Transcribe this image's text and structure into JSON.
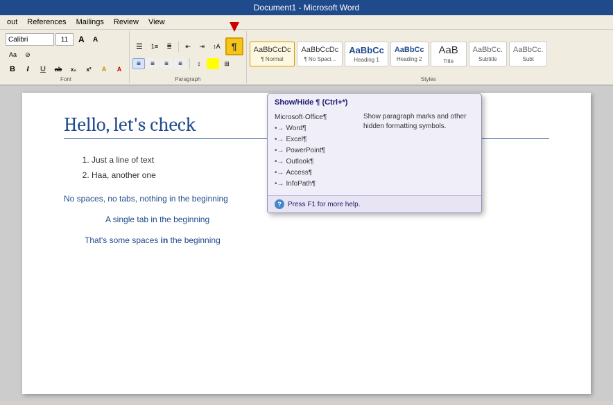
{
  "titleBar": {
    "text": "Document1 - Microsoft Word"
  },
  "menuBar": {
    "items": [
      "out",
      "References",
      "Mailings",
      "Review",
      "View"
    ]
  },
  "ribbon": {
    "fontSection": {
      "label": "Font",
      "fontName": "Calibri",
      "fontSize": "11",
      "formatButtons": [
        "B",
        "I",
        "U",
        "ab",
        "x₂",
        "x²",
        "Aa",
        "A",
        "A"
      ]
    },
    "paragraphSection": {
      "label": "Paragraph"
    },
    "stylesSection": {
      "label": "Styles",
      "styles": [
        {
          "name": "¶ Normal",
          "label": "¶ Normal",
          "sublabel": ""
        },
        {
          "name": "¶ No Spaci...",
          "label": "¶ No Spaci...",
          "sublabel": ""
        },
        {
          "name": "Heading 1",
          "label": "Heading 1",
          "sublabel": ""
        },
        {
          "name": "Heading 2",
          "label": "Heading 2",
          "sublabel": ""
        },
        {
          "name": "Title",
          "label": "Title",
          "sublabel": ""
        },
        {
          "name": "Subtitle",
          "label": "Subtitle",
          "sublabel": ""
        },
        {
          "name": "AaBbCc.",
          "label": "Subt",
          "sublabel": ""
        }
      ]
    },
    "pilcrowButton": "¶"
  },
  "tooltip": {
    "title": "Show/Hide ¶ (Ctrl+*)",
    "previewTitle": "Microsoft·Office¶",
    "previewItems": [
      "Word¶",
      "Excel¶",
      "PowerPoint¶",
      "Outlook¶",
      "Access¶",
      "InfoPath¶"
    ],
    "description": "Show paragraph marks and other hidden formatting symbols.",
    "helpText": "Press F1 for more help."
  },
  "document": {
    "heading": "Hello, let's check",
    "listItems": [
      "Just a line of text",
      "Haa, another one"
    ],
    "paragraphs": [
      {
        "text": "No spaces, no tabs, nothing in the beginning",
        "indent": "none"
      },
      {
        "text": "A single tab in the beginning",
        "indent": "tab"
      },
      {
        "text": "That's some spaces in the beginning",
        "indent": "space"
      }
    ]
  }
}
